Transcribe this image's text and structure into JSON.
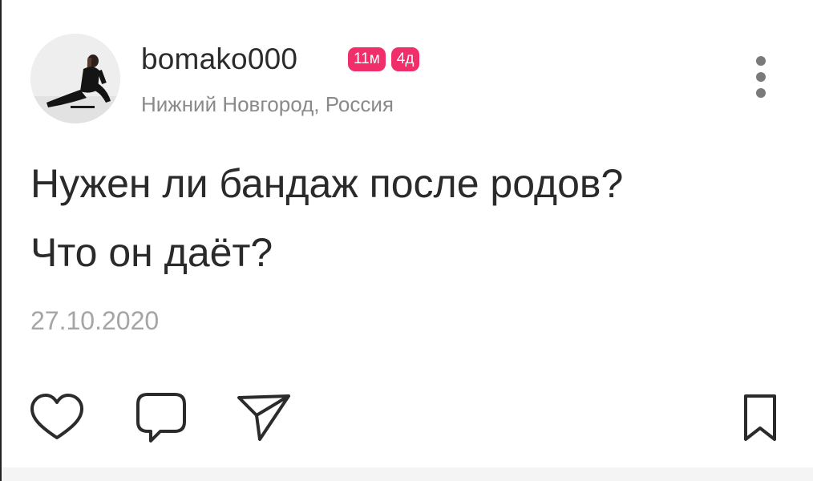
{
  "post": {
    "author": {
      "username": "bomako000",
      "badges": [
        "11м",
        "4д"
      ],
      "location": "Нижний Новгород, Россия"
    },
    "text_lines": [
      "Нужен ли бандаж после родов?",
      "Что он даёт?"
    ],
    "date": "27.10.2020"
  },
  "actions": {
    "icons": [
      "heart-icon",
      "comment-icon",
      "share-icon",
      "bookmark-icon"
    ]
  },
  "colors": {
    "badge": "#ef2e6a",
    "text": "#2a2a2a",
    "muted": "#8a8a8a",
    "icon": "#2b2b2b"
  }
}
